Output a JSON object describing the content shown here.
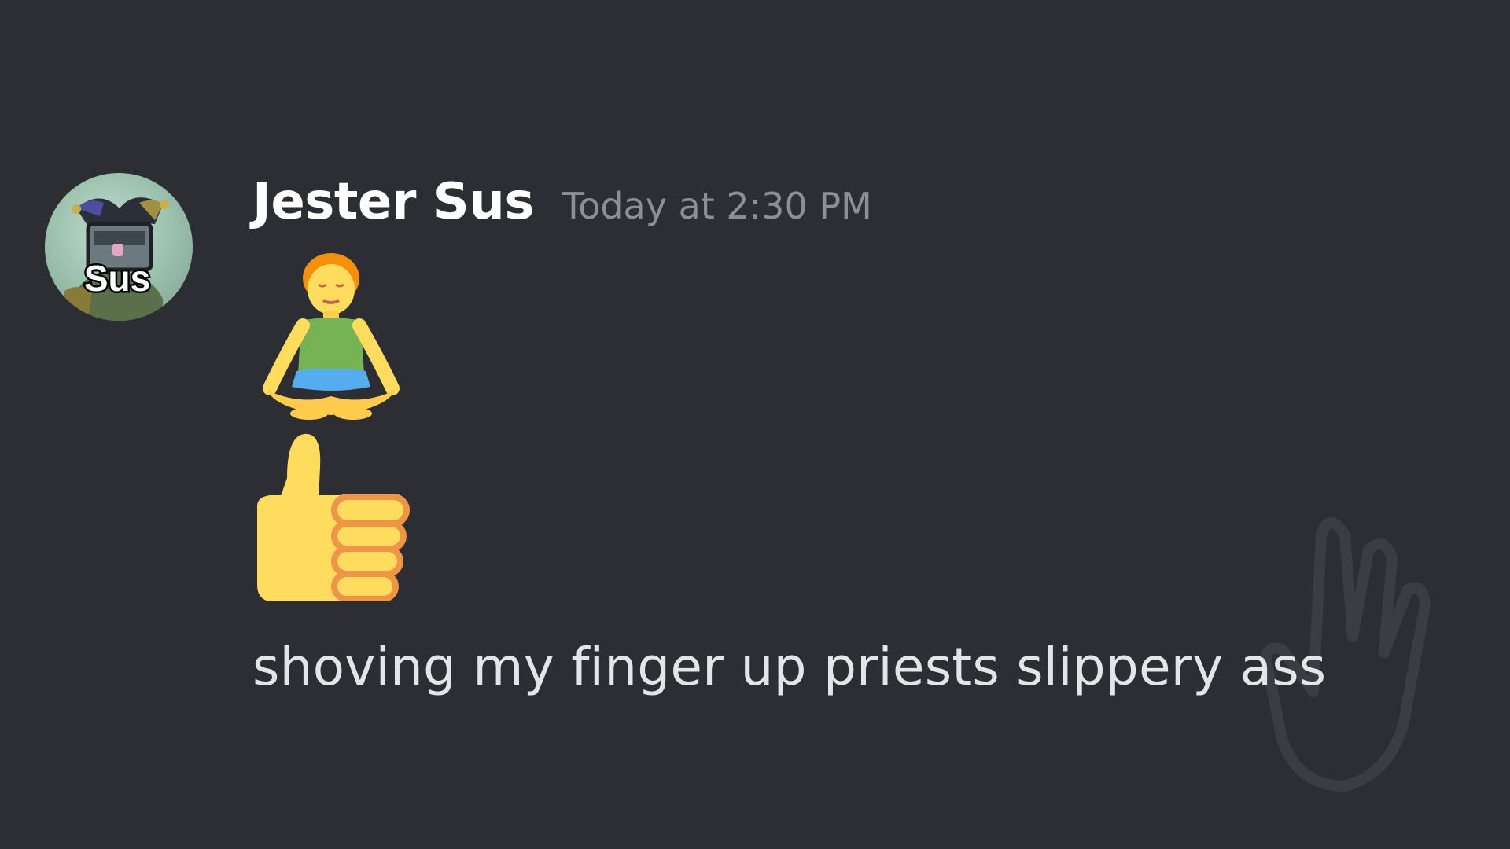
{
  "message": {
    "author": "Jester Sus",
    "timestamp": "Today at 2:30 PM",
    "avatar_label": "Sus",
    "emojis": [
      {
        "icon": "person-in-lotus-position-icon"
      },
      {
        "icon": "thumbs-up-icon"
      }
    ],
    "text": "shoving my finger up priests slippery ass"
  },
  "colors": {
    "background": "#2d2e33",
    "username": "#ffffff",
    "timestamp": "#8c8f96",
    "text": "#e3e5e8"
  }
}
